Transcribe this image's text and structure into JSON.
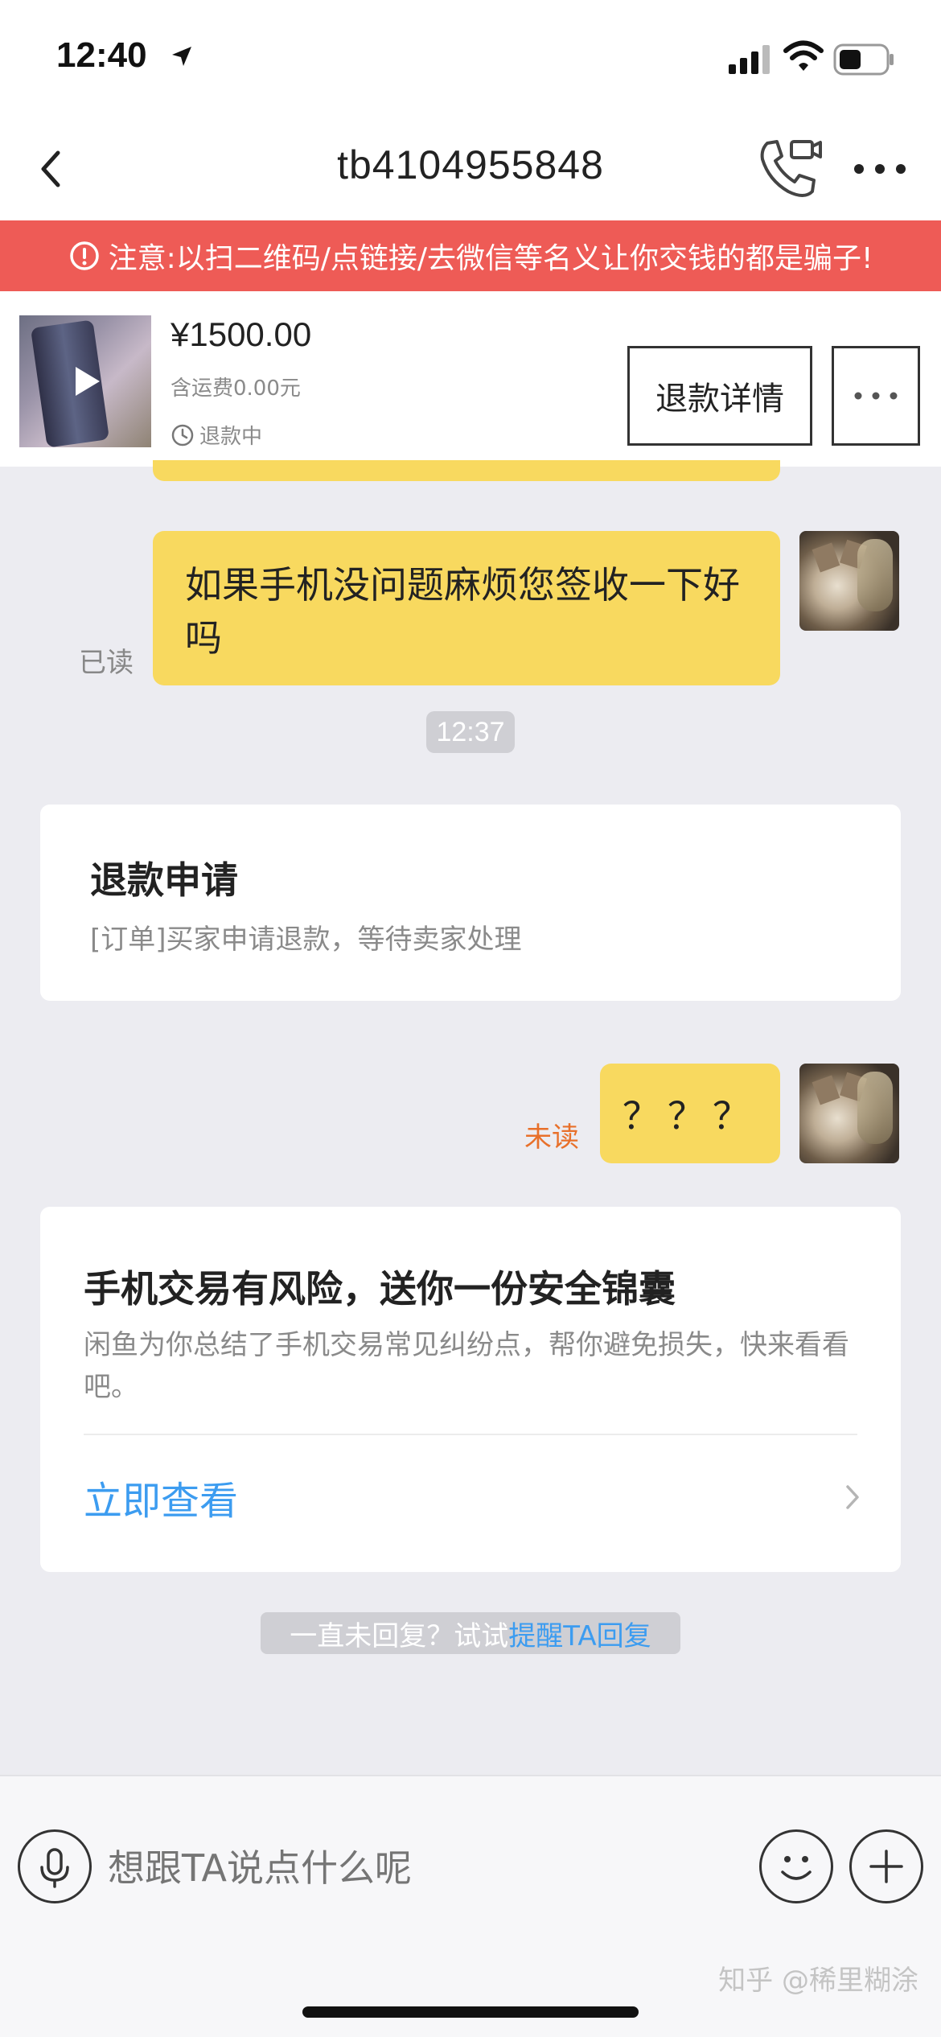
{
  "status_bar": {
    "time": "12:40"
  },
  "nav": {
    "title": "tb4104955848"
  },
  "warning": {
    "text": "注意:以扫二维码/点链接/去微信等名义让你交钱的都是骗子!"
  },
  "product": {
    "price": "¥1500.00",
    "shipping": "含运费0.00元",
    "status": "退款中",
    "refund_button": "退款详情"
  },
  "chat": {
    "message1": "如果手机没问题麻烦您签收一下好吗",
    "read_label": "已读",
    "timestamp": "12:37",
    "refund_card": {
      "title": "退款申请",
      "desc": "[订单]买家申请退款，等待卖家处理"
    },
    "message2": "？？？",
    "unread_label": "未读",
    "safety_card": {
      "title": "手机交易有风险，送你一份安全锦囊",
      "desc": "闲鱼为你总结了手机交易常见纠纷点，帮你避免损失，快来看看吧。",
      "link": "立即查看"
    },
    "nudge_prefix": "一直未回复？试试",
    "nudge_link": "提醒TA回复"
  },
  "input": {
    "placeholder": "想跟TA说点什么呢"
  },
  "watermark": "知乎 @稀里糊涂",
  "colors": {
    "warning_bg": "#ee5b56",
    "bubble": "#f8d95f",
    "link": "#3c9cf0",
    "unread": "#e8702a"
  }
}
